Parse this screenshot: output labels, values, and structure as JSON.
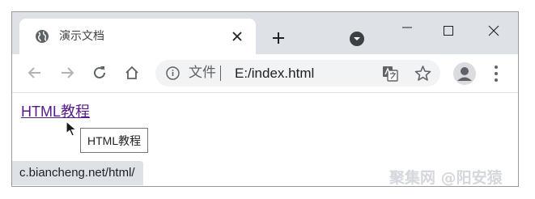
{
  "tab": {
    "title": "演示文档",
    "favicon": "globe-icon"
  },
  "toolbar": {
    "location_label": "文件",
    "url": "E:/index.html"
  },
  "page": {
    "link_text": "HTML教程",
    "tooltip_text": "HTML教程"
  },
  "status": {
    "url": "c.biancheng.net/html/"
  },
  "watermark": {
    "text": "聚集网 @阳安猿"
  },
  "colors": {
    "tabstrip": "#dee1e6",
    "omnibox": "#f1f3f4",
    "visited_link": "#551a8b",
    "icon": "#5f6368"
  }
}
